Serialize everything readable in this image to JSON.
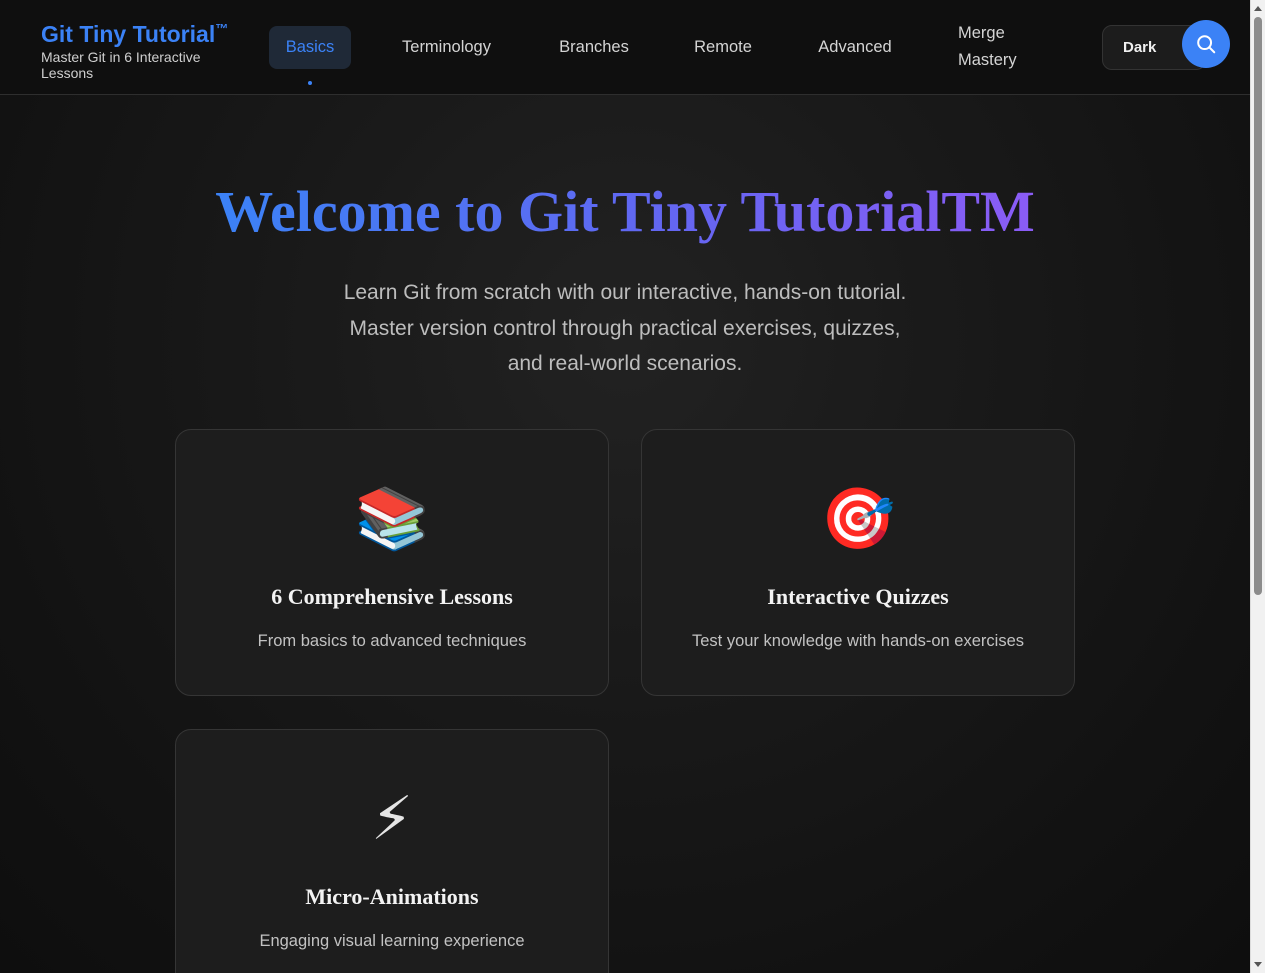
{
  "header": {
    "brand_title": "Git Tiny Tutorial",
    "brand_tm": "™",
    "brand_subtitle": "Master Git in 6 Interactive Lessons",
    "nav": [
      {
        "label": "Basics",
        "active": true
      },
      {
        "label": "Terminology",
        "active": false
      },
      {
        "label": "Branches",
        "active": false
      },
      {
        "label": "Remote",
        "active": false
      },
      {
        "label": "Advanced",
        "active": false
      },
      {
        "label": "Merge Mastery",
        "active": false
      }
    ],
    "theme_toggle_label": "Dark",
    "search_icon": "search-icon"
  },
  "hero": {
    "title": "Welcome to Git Tiny TutorialTM",
    "description": "Learn Git from scratch with our interactive, hands-on tutorial. Master version control through practical exercises, quizzes, and real-world scenarios."
  },
  "features": [
    {
      "icon": "📚",
      "icon_name": "books-icon",
      "title": "6 Comprehensive Lessons",
      "description": "From basics to advanced techniques"
    },
    {
      "icon": "🎯",
      "icon_name": "target-icon",
      "title": "Interactive Quizzes",
      "description": "Test your knowledge with hands-on exercises"
    },
    {
      "icon": "⚡",
      "icon_name": "lightning-icon",
      "title": "Micro-Animations",
      "description": "Engaging visual learning experience"
    }
  ],
  "colors": {
    "accent": "#3b82f6",
    "gradient_end": "#8b5cf6",
    "background": "#121212"
  }
}
